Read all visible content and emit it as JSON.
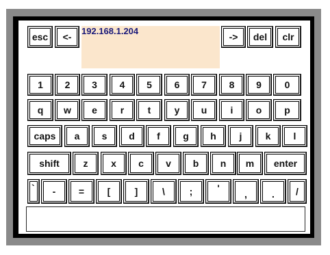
{
  "display": {
    "value": "192.168.1.204"
  },
  "top_row": {
    "esc": "esc",
    "back": "<-",
    "forward": "->",
    "del": "del",
    "clr": "clr"
  },
  "rows": {
    "numbers": [
      "1",
      "2",
      "3",
      "4",
      "5",
      "6",
      "7",
      "8",
      "9",
      "0"
    ],
    "qwerty": [
      "q",
      "w",
      "e",
      "r",
      "t",
      "y",
      "u",
      "i",
      "o",
      "p"
    ],
    "home": [
      "caps",
      "a",
      "s",
      "d",
      "f",
      "g",
      "h",
      "j",
      "k",
      "l"
    ],
    "bottom": [
      "shift",
      "z",
      "x",
      "c",
      "v",
      "b",
      "n",
      "m",
      "enter"
    ],
    "symbols": [
      "`",
      "-",
      "=",
      "[",
      "]",
      "\\",
      ";",
      "'",
      ",",
      ".",
      "/"
    ]
  },
  "input": {
    "value": ""
  }
}
